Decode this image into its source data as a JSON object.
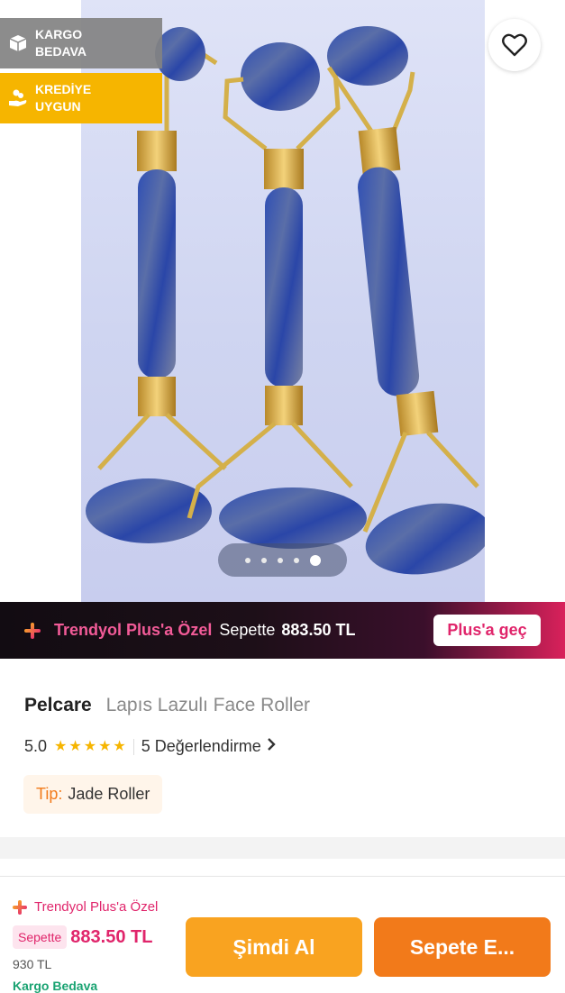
{
  "hero": {
    "badges": [
      {
        "line1": "KARGO",
        "line2": "BEDAVA",
        "icon": "package-icon"
      },
      {
        "line1": "KREDİYE",
        "line2": "UYGUN",
        "icon": "hand-coins-icon"
      }
    ],
    "favorite_icon": "heart-icon",
    "image_count": 5,
    "active_image": 5
  },
  "plus_banner": {
    "title": "Trendyol Plus'a Özel",
    "sepette": "Sepette",
    "price": "883.50 TL",
    "button": "Plus'a geç"
  },
  "product": {
    "brand": "Pelcare",
    "name": "Lapıs Lazulı Face Roller",
    "rating": "5.0",
    "rating_value": 5,
    "reviews": "5 Değerlendirme",
    "tip_label": "Tip:",
    "tip_value": "Jade Roller"
  },
  "bottom_bar": {
    "plus_label": "Trendyol Plus'a Özel",
    "sepette_chip": "Sepette",
    "price": "883.50 TL",
    "old_price": "930 TL",
    "cargo": "Kargo Bedava",
    "buy_now": "Şimdi Al",
    "add_to_cart": "Sepete E..."
  },
  "colors": {
    "orange": "#f27a1a",
    "plus_pink": "#e0256b",
    "star": "#f6b500",
    "credit_badge": "#f6b500"
  }
}
